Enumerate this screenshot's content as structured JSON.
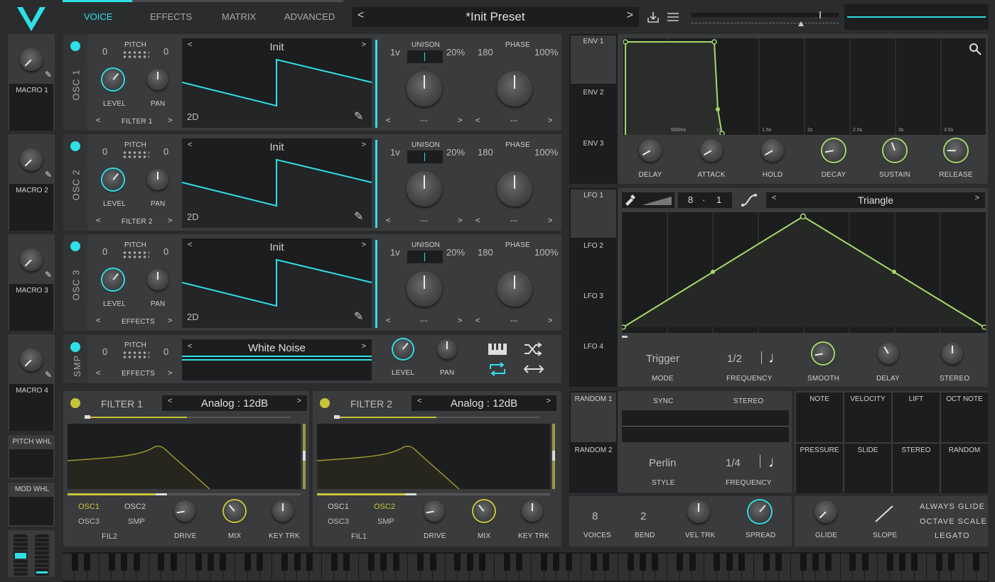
{
  "tabs": [
    "VOICE",
    "EFFECTS",
    "MATRIX",
    "ADVANCED"
  ],
  "preset": {
    "name": "*Init Preset"
  },
  "colors": {
    "accent": "#2ee0e6",
    "env": "#a6d96a",
    "filter": "#c8c43a",
    "bg": "#2b2c2e",
    "panel": "#3a3b3d"
  },
  "macros": [
    "MACRO 1",
    "MACRO 2",
    "MACRO 3",
    "MACRO 4"
  ],
  "wheels": [
    "PITCH WHL",
    "MOD WHL"
  ],
  "osc": [
    {
      "label": "OSC 1",
      "pitch_l": "0",
      "pitch_r": "0",
      "pitch": "PITCH",
      "level": "LEVEL",
      "pan": "PAN",
      "dest": "FILTER 1",
      "wave": "Init",
      "dim": "2D",
      "unison": "UNISON",
      "voices": "1v",
      "detune": "20%",
      "phase_l": "180",
      "phase": "PHASE",
      "phase_r": "100%",
      "uni_dash": "---",
      "ph_dash": "---"
    },
    {
      "label": "OSC 2",
      "pitch_l": "0",
      "pitch_r": "0",
      "pitch": "PITCH",
      "level": "LEVEL",
      "pan": "PAN",
      "dest": "FILTER 2",
      "wave": "Init",
      "dim": "2D",
      "unison": "UNISON",
      "voices": "1v",
      "detune": "20%",
      "phase_l": "180",
      "phase": "PHASE",
      "phase_r": "100%",
      "uni_dash": "---",
      "ph_dash": "---"
    },
    {
      "label": "OSC 3",
      "pitch_l": "0",
      "pitch_r": "0",
      "pitch": "PITCH",
      "level": "LEVEL",
      "pan": "PAN",
      "dest": "EFFECTS",
      "wave": "Init",
      "dim": "2D",
      "unison": "UNISON",
      "voices": "1v",
      "detune": "20%",
      "phase_l": "180",
      "phase": "PHASE",
      "phase_r": "100%",
      "uni_dash": "---",
      "ph_dash": "---"
    }
  ],
  "smp": {
    "label": "SMP",
    "pitch_l": "0",
    "pitch_r": "0",
    "pitch": "PITCH",
    "dest": "EFFECTS",
    "sample": "White Noise",
    "level": "LEVEL",
    "pan": "PAN"
  },
  "filters": [
    {
      "title": "FILTER 1",
      "model": "Analog : 12dB",
      "src": [
        "OSC1",
        "OSC2",
        "OSC3",
        "SMP"
      ],
      "fil": "FIL2",
      "drive": "DRIVE",
      "mix": "MIX",
      "key": "KEY TRK"
    },
    {
      "title": "FILTER 2",
      "model": "Analog : 12dB",
      "src": [
        "OSC1",
        "OSC2",
        "OSC3",
        "SMP"
      ],
      "fil": "FIL1",
      "drive": "DRIVE",
      "mix": "MIX",
      "key": "KEY TRK"
    }
  ],
  "env": {
    "tabs": [
      "ENV 1",
      "ENV 2",
      "ENV 3"
    ],
    "times": [
      "500ms",
      "1s",
      "1.5s",
      "2s",
      "2.5s",
      "3s",
      "3.5s"
    ],
    "knobs": [
      "DELAY",
      "ATTACK",
      "HOLD",
      "DECAY",
      "SUSTAIN",
      "RELEASE"
    ]
  },
  "lfo": {
    "tabs": [
      "LFO 1",
      "LFO 2",
      "LFO 3",
      "LFO 4"
    ],
    "grid_l": "8",
    "grid_dot": "·",
    "grid_r": "1",
    "shape": "Triangle",
    "mode_val": "Trigger",
    "freq_val": "1/2",
    "mode": "MODE",
    "freq": "FREQUENCY",
    "smooth": "SMOOTH",
    "delay": "DELAY",
    "stereo": "STEREO"
  },
  "random": {
    "tabs": [
      "RANDOM 1",
      "RANDOM 2"
    ],
    "sync": "SYNC",
    "stereo": "STEREO",
    "style_val": "Perlin",
    "freq_val": "1/4",
    "style": "STYLE",
    "freq": "FREQUENCY"
  },
  "mod_grid": [
    "NOTE",
    "VELOCITY",
    "LIFT",
    "OCT NOTE",
    "PRESSURE",
    "SLIDE",
    "STEREO",
    "RANDOM"
  ],
  "voice": {
    "voices_val": "8",
    "bend_val": "2",
    "voices": "VOICES",
    "bend": "BEND",
    "vel": "VEL TRK",
    "spread": "SPREAD"
  },
  "glide": {
    "glide": "GLIDE",
    "slope": "SLOPE",
    "always": "ALWAYS GLIDE",
    "octave": "OCTAVE SCALE",
    "legato": "LEGATO"
  }
}
